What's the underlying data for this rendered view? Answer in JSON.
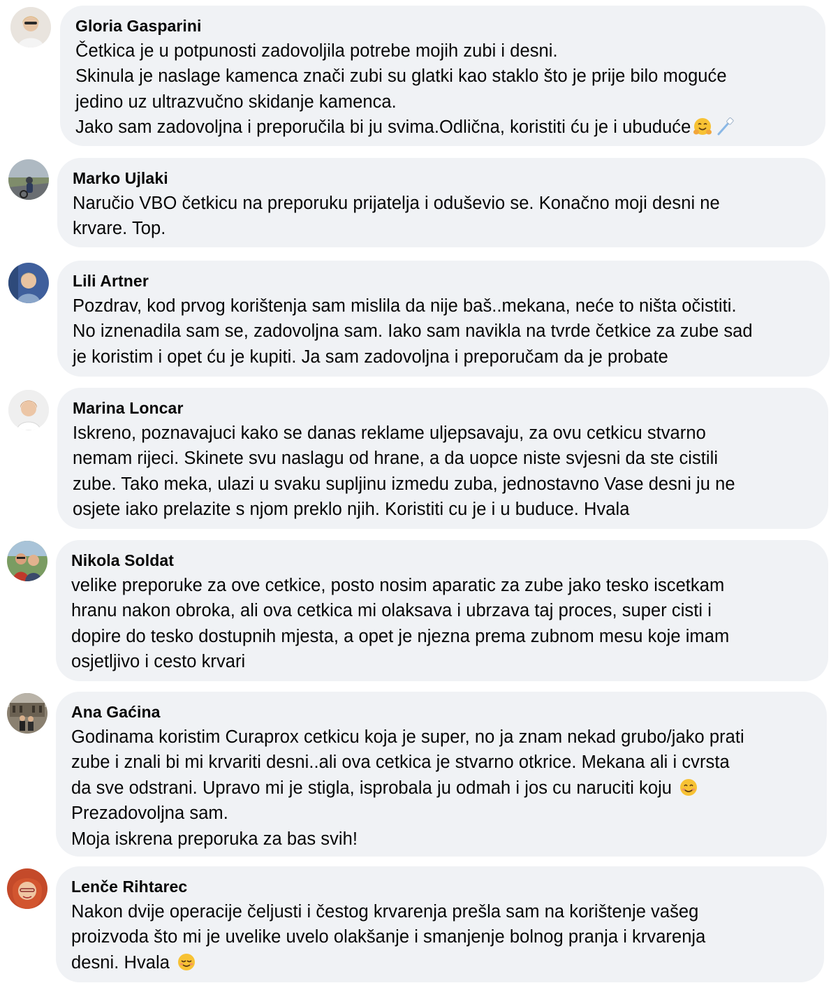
{
  "comments": [
    {
      "author": "Gloria Gasparini",
      "lines": [
        "Četkica je u potpunosti zadovoljila potrebe mojih zubi i desni.",
        "Skinula je naslage kamenca znači zubi su glatki kao staklo što je prije bilo moguće",
        "jedino uz ultrazvučno skidanje kamenca.",
        "Jako sam zadovoljna i preporučila bi ju svima.Odlična, koristiti ću je i ubuduće"
      ],
      "emojis": [
        "hugging-face-icon",
        "toothbrush-icon"
      ]
    },
    {
      "author": "Marko Ujlaki",
      "lines": [
        "Naručio VBO četkicu na preporuku prijatelja i oduševio se. Konačno moji desni ne",
        "krvare. Top."
      ]
    },
    {
      "author": "Lili Artner",
      "lines": [
        "Pozdrav, kod prvog korištenja sam mislila da nije baš..mekana, neće to ništa očistiti.",
        "No iznenadila sam se, zadovoljna sam. Iako sam navikla na tvrde četkice za zube sad",
        "je koristim i opet ću je kupiti. Ja sam zadovoljna i preporučam da je probate"
      ]
    },
    {
      "author": "Marina Loncar",
      "lines": [
        "Iskreno, poznavajuci kako se danas reklame uljepsavaju, za ovu cetkicu stvarno",
        "nemam rijeci. Skinete svu naslagu od hrane, a da uopce niste svjesni da ste cistili",
        "zube. Tako meka, ulazi u svaku supljinu izmedu zuba, jednostavno Vase desni ju ne",
        "osjete iako prelazite s njom preklo njih. Koristiti cu je i u buduce. Hvala"
      ]
    },
    {
      "author": "Nikola Soldat",
      "lines": [
        "velike preporuke za ove cetkice, posto nosim aparatic za zube jako tesko iscetkam",
        "hranu nakon obroka, ali ova cetkica mi olaksava i ubrzava taj proces, super cisti i",
        "dopire do tesko dostupnih mjesta, a opet je njezna prema zubnom mesu koje imam",
        "osjetljivo i cesto krvari"
      ]
    },
    {
      "author": "Ana Gaćina",
      "lines": [
        "Godinama koristim Curaprox cetkicu koja je super, no ja znam nekad grubo/jako prati",
        "zube i znali bi mi krvariti desni..ali ova cetkica je stvarno otkrice. Mekana ali i cvrsta",
        "da sve odstrani. Upravo mi je stigla, isprobala ju odmah i jos cu naruciti koju",
        "Prezadovoljna sam.",
        "Moja iskrena preporuka za bas svih!"
      ],
      "emojis": [
        "smiling-face-icon"
      ]
    },
    {
      "author": "Lenče Rihtarec",
      "lines": [
        "Nakon dvije operacije čeljusti i čestog krvarenja prešla sam na korištenje vašeg",
        "proizvoda što mi je uvelike uvelo olakšanje i smanjenje bolnog pranja i krvarenja",
        "desni. Hvala"
      ],
      "emojis": [
        "relieved-face-icon"
      ]
    }
  ],
  "colors": {
    "bubble": "#f0f2f5",
    "text": "#050505",
    "background": "#ffffff"
  }
}
